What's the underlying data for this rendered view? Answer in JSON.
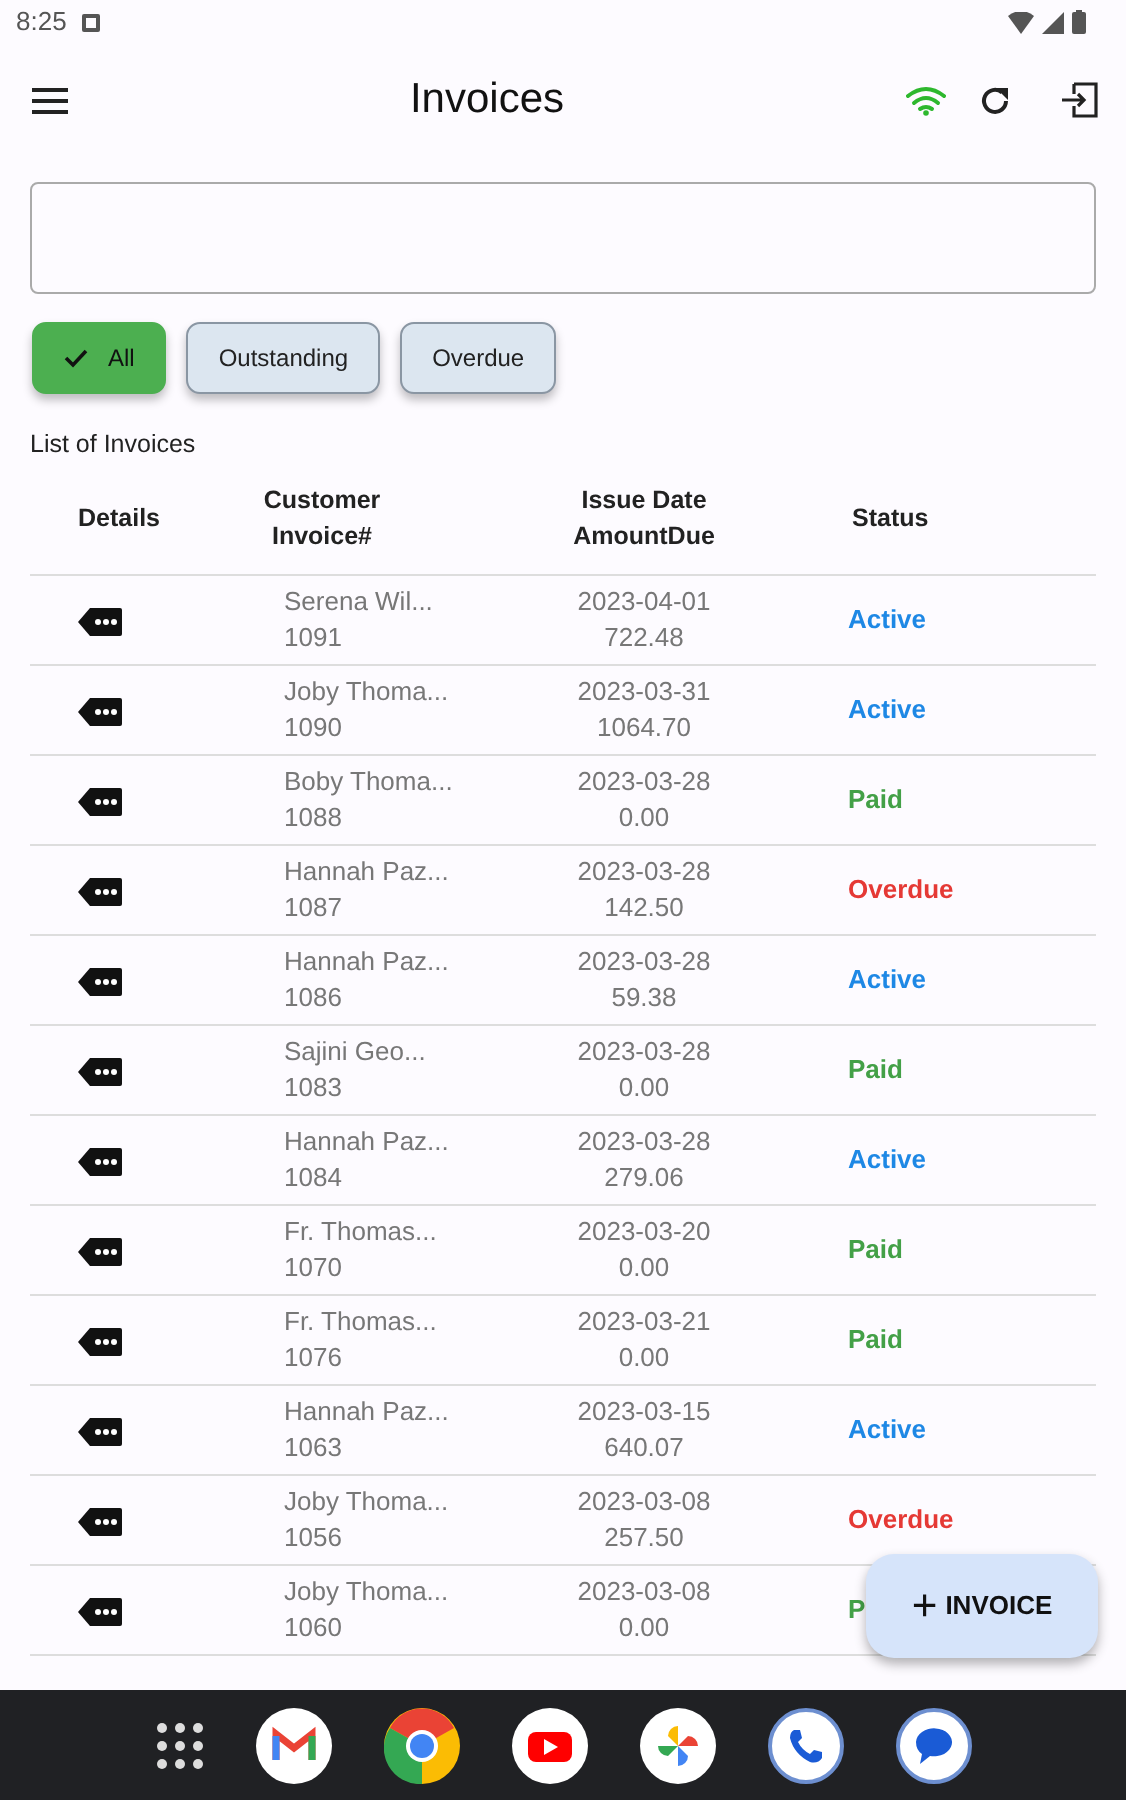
{
  "status_bar": {
    "time": "8:25"
  },
  "app_bar": {
    "title": "Invoices",
    "connected": true
  },
  "filters": [
    {
      "label": "All",
      "selected": true
    },
    {
      "label": "Outstanding",
      "selected": false
    },
    {
      "label": "Overdue",
      "selected": false
    }
  ],
  "list_title": "List of Invoices",
  "columns": [
    {
      "title": "Details"
    },
    {
      "title": "Customer",
      "subtitle": "Invoice#"
    },
    {
      "title": "Issue Date",
      "subtitle": "AmountDue"
    },
    {
      "title": "Status"
    }
  ],
  "rows": [
    {
      "customer": "Serena Wil...",
      "invoice": "1091",
      "date": "2023-04-01",
      "amount": "722.48",
      "status": "Active",
      "color": "#1e88e5"
    },
    {
      "customer": "Joby Thoma...",
      "invoice": "1090",
      "date": "2023-03-31",
      "amount": "1064.70",
      "status": "Active",
      "color": "#1e88e5"
    },
    {
      "customer": "Boby Thoma...",
      "invoice": "1088",
      "date": "2023-03-28",
      "amount": "0.00",
      "status": "Paid",
      "color": "#43a047"
    },
    {
      "customer": "Hannah Paz...",
      "invoice": "1087",
      "date": "2023-03-28",
      "amount": "142.50",
      "status": "Overdue",
      "color": "#e53935"
    },
    {
      "customer": "Hannah Paz...",
      "invoice": "1086",
      "date": "2023-03-28",
      "amount": "59.38",
      "status": "Active",
      "color": "#1e88e5"
    },
    {
      "customer": "Sajini Geo...",
      "invoice": "1083",
      "date": "2023-03-28",
      "amount": "0.00",
      "status": "Paid",
      "color": "#43a047"
    },
    {
      "customer": "Hannah Paz...",
      "invoice": "1084",
      "date": "2023-03-28",
      "amount": "279.06",
      "status": "Active",
      "color": "#1e88e5"
    },
    {
      "customer": "Fr. Thomas...",
      "invoice": "1070",
      "date": "2023-03-20",
      "amount": "0.00",
      "status": "Paid",
      "color": "#43a047"
    },
    {
      "customer": "Fr. Thomas...",
      "invoice": "1076",
      "date": "2023-03-21",
      "amount": "0.00",
      "status": "Paid",
      "color": "#43a047"
    },
    {
      "customer": "Hannah Paz...",
      "invoice": "1063",
      "date": "2023-03-15",
      "amount": "640.07",
      "status": "Active",
      "color": "#1e88e5"
    },
    {
      "customer": "Joby Thoma...",
      "invoice": "1056",
      "date": "2023-03-08",
      "amount": "257.50",
      "status": "Overdue",
      "color": "#e53935"
    },
    {
      "customer": "Joby Thoma...",
      "invoice": "1060",
      "date": "2023-03-08",
      "amount": "0.00",
      "status": "P",
      "color": "#43a047"
    }
  ],
  "fab": {
    "icon": "+",
    "label": "INVOICE"
  }
}
